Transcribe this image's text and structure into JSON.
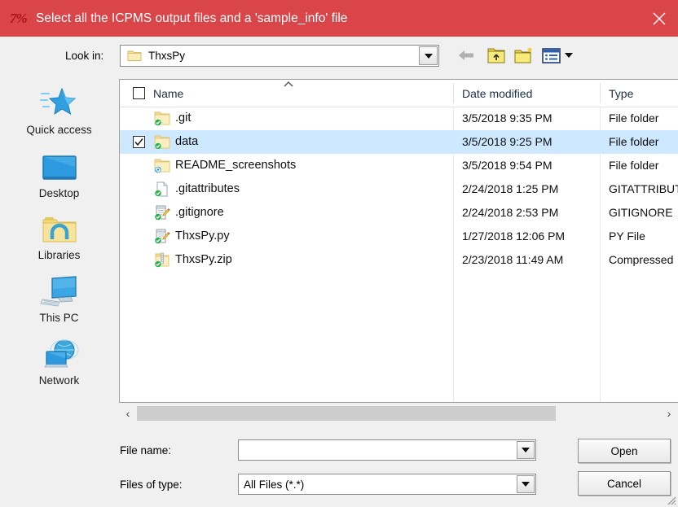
{
  "window": {
    "title": "Select all the ICPMS output files and a 'sample_info' file",
    "icon": "app-logo-icon",
    "icon_glyph": "7%",
    "close_label": "Close",
    "titlebar_color": "#d94548"
  },
  "toolbar": {
    "lookin_label": "Look in:",
    "lookin_value": "ThxsPy",
    "lookin_icon": "folder-icon",
    "buttons": [
      {
        "name": "back-button",
        "icon": "back-arrow-icon"
      },
      {
        "name": "up-one-level-button",
        "icon": "up-folder-icon"
      },
      {
        "name": "new-folder-button",
        "icon": "new-folder-icon"
      },
      {
        "name": "view-menu-button",
        "icon": "view-list-icon"
      }
    ]
  },
  "places": [
    {
      "label": "Quick access",
      "icon": "star-icon"
    },
    {
      "label": "Desktop",
      "icon": "monitor-icon"
    },
    {
      "label": "Libraries",
      "icon": "libraries-folder-icon"
    },
    {
      "label": "This PC",
      "icon": "computer-icon"
    },
    {
      "label": "Network",
      "icon": "network-globe-icon"
    }
  ],
  "columns": [
    {
      "key": "name",
      "label": "Name"
    },
    {
      "key": "date",
      "label": "Date modified"
    },
    {
      "key": "type",
      "label": "Type"
    }
  ],
  "sort": {
    "column": "Name",
    "direction": "ascending"
  },
  "files": [
    {
      "name": ".git",
      "date": "3/5/2018 9:35 PM",
      "type": "File folder",
      "icon": "folder-icon",
      "badge": "sync-ok-badge",
      "checked": false,
      "selected": false
    },
    {
      "name": "data",
      "date": "3/5/2018 9:25 PM",
      "type": "File folder",
      "icon": "folder-icon",
      "badge": "sync-ok-badge",
      "checked": true,
      "selected": true
    },
    {
      "name": "README_screenshots",
      "date": "3/5/2018 9:54 PM",
      "type": "File folder",
      "icon": "folder-icon",
      "badge": "sync-pending-badge",
      "checked": false,
      "selected": false
    },
    {
      "name": ".gitattributes",
      "date": "2/24/2018 1:25 PM",
      "type": "GITATTRIBUTE",
      "icon": "blank-document-icon",
      "badge": "sync-ok-badge",
      "checked": false,
      "selected": false
    },
    {
      "name": ".gitignore",
      "date": "2/24/2018 2:53 PM",
      "type": "GITIGNORE",
      "icon": "text-editor-document-icon",
      "badge": "sync-ok-badge",
      "checked": false,
      "selected": false
    },
    {
      "name": "ThxsPy.py",
      "date": "1/27/2018 12:06 PM",
      "type": "PY File",
      "icon": "text-editor-document-icon",
      "badge": "sync-ok-badge",
      "checked": false,
      "selected": false
    },
    {
      "name": "ThxsPy.zip",
      "date": "2/23/2018 11:49 AM",
      "type": "Compressed",
      "icon": "zip-folder-icon",
      "badge": "sync-ok-badge",
      "checked": false,
      "selected": false
    }
  ],
  "form": {
    "filename_label": "File name:",
    "filename_value": "",
    "filename_placeholder": "",
    "filetype_label": "Files of type:",
    "filetype_value": "All Files (*.*)",
    "open_label": "Open",
    "cancel_label": "Cancel"
  },
  "scrollbar": {
    "left_arrow": "‹",
    "right_arrow": "›"
  }
}
